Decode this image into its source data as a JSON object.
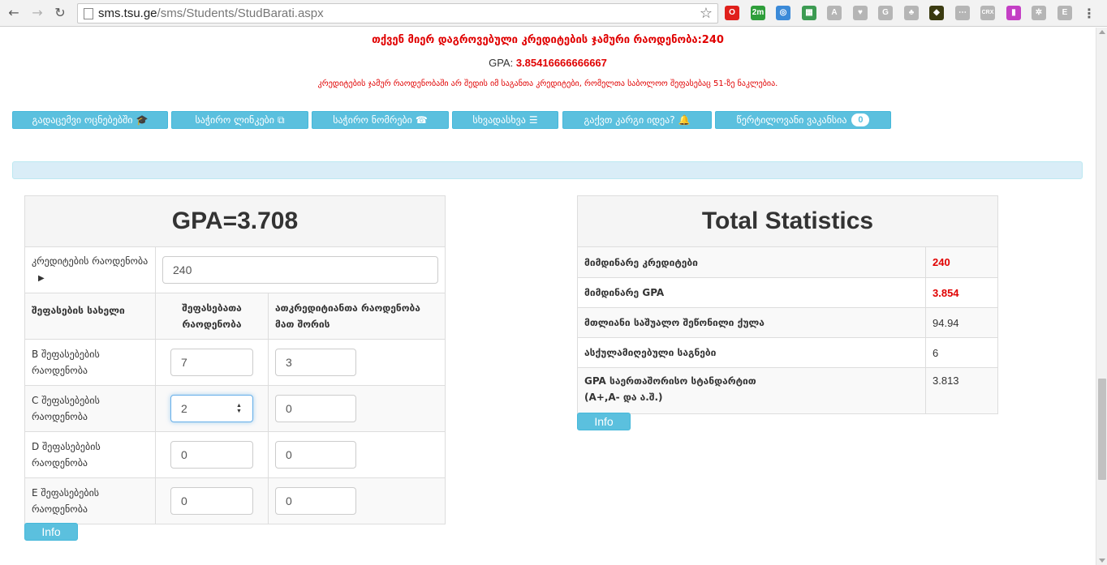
{
  "browser": {
    "url_host": "sms.tsu.ge",
    "url_path": "/sms/Students/StudBarati.aspx",
    "extensions": [
      {
        "name": "opera-icon",
        "color": "#e0201b",
        "label": "O"
      },
      {
        "name": "2m-icon",
        "color": "#2e9e3a",
        "label": "2m"
      },
      {
        "name": "blue-circle-icon",
        "color": "#3b8ad8",
        "label": "◎"
      },
      {
        "name": "sheet-icon",
        "color": "#3c9b52",
        "label": "▦"
      },
      {
        "name": "angular-icon",
        "color": "#b5b5b5",
        "label": "A"
      },
      {
        "name": "pattern-icon",
        "color": "#b5b5b5",
        "label": "♥"
      },
      {
        "name": "g-icon",
        "color": "#b5b5b5",
        "label": "G"
      },
      {
        "name": "network-icon",
        "color": "#b5b5b5",
        "label": "♣"
      },
      {
        "name": "dark-icon",
        "color": "#3b3b10",
        "label": "◆"
      },
      {
        "name": "dots-icon",
        "color": "#b5b5b5",
        "label": "⋯"
      },
      {
        "name": "crx-icon",
        "color": "#b5b5b5",
        "label": "CRX"
      },
      {
        "name": "color-icon",
        "color": "#c43fc5",
        "label": "▮"
      },
      {
        "name": "react-icon",
        "color": "#b5b5b5",
        "label": "✲"
      },
      {
        "name": "e-icon",
        "color": "#b5b5b5",
        "label": "E"
      }
    ]
  },
  "summary": {
    "credits_total": "თქვენ მიერ დაგროვებული კრედიტების ჯამური რაოდენობა:240",
    "gpa_label": "GPA:",
    "gpa_value": "3.85416666666667",
    "note": "კრედიტების ჯამურ რაოდენობაში არ შედის იმ საგანთა კრედიტები, რომელთა საბოლოო შეფასებაც 51-ზე ნაკლებია."
  },
  "nav_buttons": [
    {
      "name": "transfer-exams-button",
      "label": "გადაცემვი ოცნებებში",
      "icon": "🎓"
    },
    {
      "name": "useful-links-button",
      "label": "საჭირო ლინკები",
      "icon": "⧉"
    },
    {
      "name": "useful-numbers-button",
      "label": "საჭირო ნომრები",
      "icon": "☎"
    },
    {
      "name": "misc-button",
      "label": "სხვადასხვა",
      "icon": "☰"
    },
    {
      "name": "good-idea-button",
      "label": "გაქვთ კარგი იდეა?",
      "icon": "🔔"
    },
    {
      "name": "vacancies-button",
      "label": "წერტილოვანი ვაკანსია",
      "badge": "0"
    }
  ],
  "calculator": {
    "title": "GPA=3.708",
    "credits_label": "კრედიტების რაოდენობა",
    "credits_arrow": "▶",
    "credits_value": "240",
    "col1": "შეფასების სახელი",
    "col2": "შეფასებათა რაოდენობა",
    "col3": "ათკრედიტიანთა რაოდენობა მათ შორის",
    "rows": [
      {
        "label": "B შეფასებების რაოდენობა",
        "count": "7",
        "ten": "3"
      },
      {
        "label": "C შეფასებების რაოდენობა",
        "count": "2",
        "ten": "0"
      },
      {
        "label": "D შეფასებების რაოდენობა",
        "count": "0",
        "ten": "0"
      },
      {
        "label": "E შეფასებების რაოდენობა",
        "count": "0",
        "ten": "0"
      }
    ],
    "info_label": "Info"
  },
  "stats": {
    "title": "Total Statistics",
    "rows": [
      {
        "key": "მიმდინარე კრედიტები",
        "value": "240",
        "red": true
      },
      {
        "key": "მიმდინარე GPA",
        "value": "3.854",
        "red": true
      },
      {
        "key": "მთლიანი საშუალო შეწონილი ქულა",
        "value": "94.94",
        "red": false
      },
      {
        "key": "ასქულამიღებული საგნები",
        "value": "6",
        "red": false
      },
      {
        "key": "GPA საერთაშორისო სტანდარტით",
        "key2": "(A+,A- და ა.შ.)",
        "value": "3.813",
        "red": false
      }
    ],
    "info_label": "Info"
  }
}
